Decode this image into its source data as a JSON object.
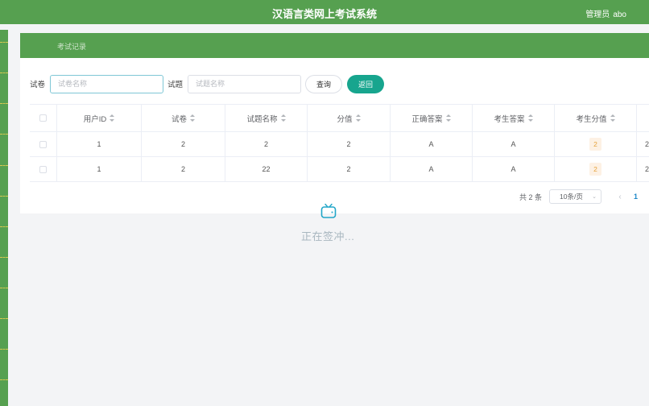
{
  "header": {
    "title": "汉语言类网上考试系统",
    "user_role": "管理员",
    "user_name": "abo"
  },
  "breadcrumb": {
    "current": "考试记录"
  },
  "search": {
    "paper_label": "试卷",
    "paper_placeholder": "试卷名称",
    "question_label": "试题",
    "question_placeholder": "试题名称",
    "query_label": "查询",
    "back_label": "返回"
  },
  "table": {
    "columns": [
      "用户ID",
      "试卷",
      "试题名称",
      "分值",
      "正确答案",
      "考生答案",
      "考生分值"
    ],
    "rows": [
      [
        "1",
        "2",
        "2",
        "2",
        "A",
        "A",
        "2"
      ],
      [
        "1",
        "2",
        "22",
        "2",
        "A",
        "A",
        "2"
      ]
    ],
    "overflow": [
      "2",
      "2"
    ]
  },
  "pagination": {
    "total": "共 2 条",
    "page_size": "10条/页",
    "current_page": "1"
  },
  "loading": {
    "text": "正在签冲..."
  },
  "colors": {
    "primary_green": "#56a050",
    "teal": "#17a58e",
    "badge_bg": "#fdf1e4",
    "badge_text": "#e6a23c"
  }
}
